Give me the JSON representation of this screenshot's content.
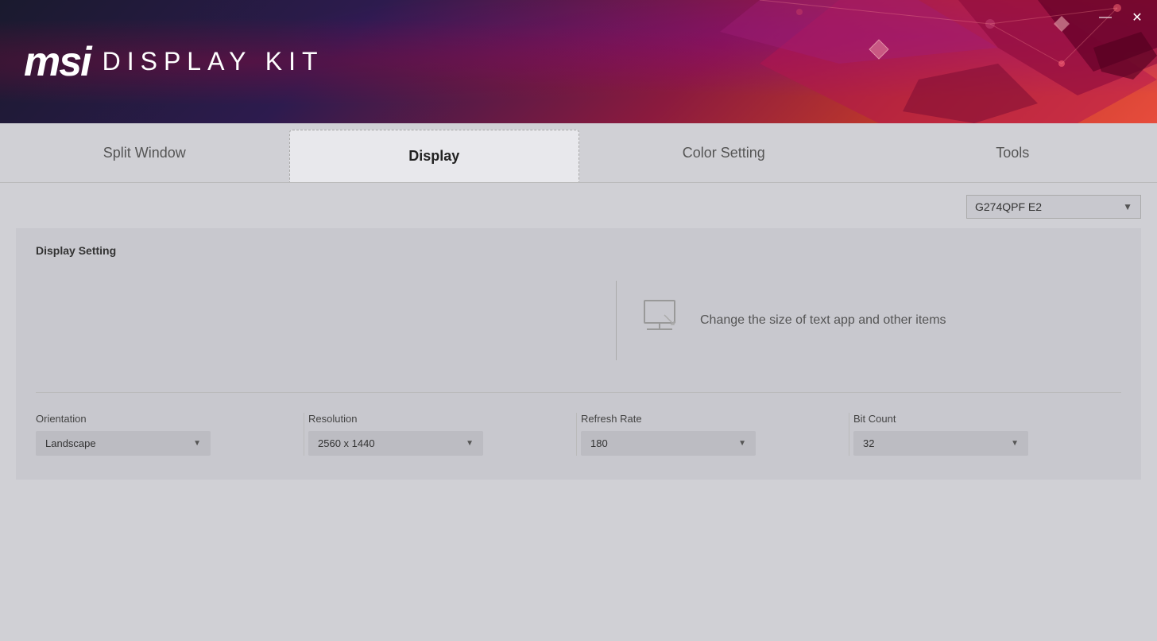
{
  "window": {
    "title": "MSI Display Kit",
    "minimize_label": "—",
    "close_label": "✕"
  },
  "header": {
    "msi_logo": "msi",
    "product_name": "DISPLAY KIT"
  },
  "nav": {
    "tabs": [
      {
        "id": "split-window",
        "label": "Split Window",
        "active": false
      },
      {
        "id": "display",
        "label": "Display",
        "active": true
      },
      {
        "id": "color-setting",
        "label": "Color Setting",
        "active": false
      },
      {
        "id": "tools",
        "label": "Tools",
        "active": false
      }
    ]
  },
  "monitor_dropdown": {
    "value": "G274QPF E2",
    "arrow": "▼"
  },
  "display_setting": {
    "title": "Display Setting",
    "change_size_text": "Change the size of text app and other items",
    "controls": {
      "orientation": {
        "label": "Orientation",
        "value": "Landscape",
        "arrow": "▼"
      },
      "resolution": {
        "label": "Resolution",
        "value": "2560 x 1440",
        "arrow": "▼"
      },
      "refresh_rate": {
        "label": "Refresh Rate",
        "value": "180",
        "arrow": "▼"
      },
      "bit_count": {
        "label": "Bit Count",
        "value": "32",
        "arrow": "▼"
      }
    }
  }
}
